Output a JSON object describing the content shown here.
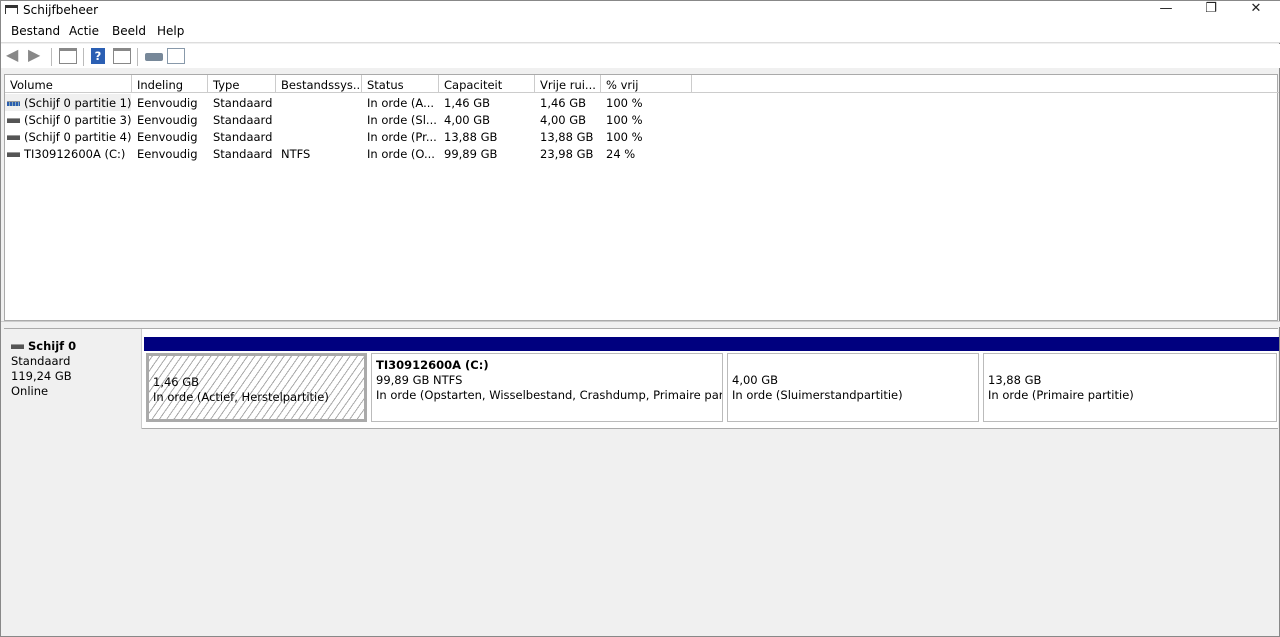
{
  "window": {
    "title": "Schijfbeheer",
    "minimize": "—",
    "restore": "❐",
    "close": "✕"
  },
  "menu": [
    "Bestand",
    "Actie",
    "Beeld",
    "Help"
  ],
  "columns": [
    "Volume",
    "Indeling",
    "Type",
    "Bestandssys...",
    "Status",
    "Capaciteit",
    "Vrije rui...",
    "% vrij"
  ],
  "rows": [
    {
      "volume": "(Schijf 0 partitie 1)",
      "indeling": "Eenvoudig",
      "type": "Standaard",
      "fs": "",
      "status": "In orde (A...",
      "cap": "1,46 GB",
      "free": "1,46 GB",
      "pct": "100 %"
    },
    {
      "volume": "(Schijf 0 partitie 3)",
      "indeling": "Eenvoudig",
      "type": "Standaard",
      "fs": "",
      "status": "In orde (Sl...",
      "cap": "4,00 GB",
      "free": "4,00 GB",
      "pct": "100 %"
    },
    {
      "volume": "(Schijf 0 partitie 4)",
      "indeling": "Eenvoudig",
      "type": "Standaard",
      "fs": "",
      "status": "In orde (Pr...",
      "cap": "13,88 GB",
      "free": "13,88 GB",
      "pct": "100 %"
    },
    {
      "volume": "TI30912600A (C:)",
      "indeling": "Eenvoudig",
      "type": "Standaard",
      "fs": "NTFS",
      "status": "In orde (O...",
      "cap": "99,89 GB",
      "free": "23,98 GB",
      "pct": "24 %"
    }
  ],
  "disk": {
    "name": "Schijf 0",
    "type": "Standaard",
    "size": "119,24 GB",
    "state": "Online"
  },
  "partitions": [
    {
      "title": "",
      "size": "1,46 GB",
      "status": "In orde (Actief, Herstelpartitie)"
    },
    {
      "title": "TI30912600A  (C:)",
      "size": "99,89 GB NTFS",
      "status": "In orde (Opstarten, Wisselbestand, Crashdump, Primaire partitie)"
    },
    {
      "title": "",
      "size": "4,00 GB",
      "status": "In orde (Sluimerstandpartitie)"
    },
    {
      "title": "",
      "size": "13,88 GB",
      "status": "In orde (Primaire partitie)"
    }
  ]
}
